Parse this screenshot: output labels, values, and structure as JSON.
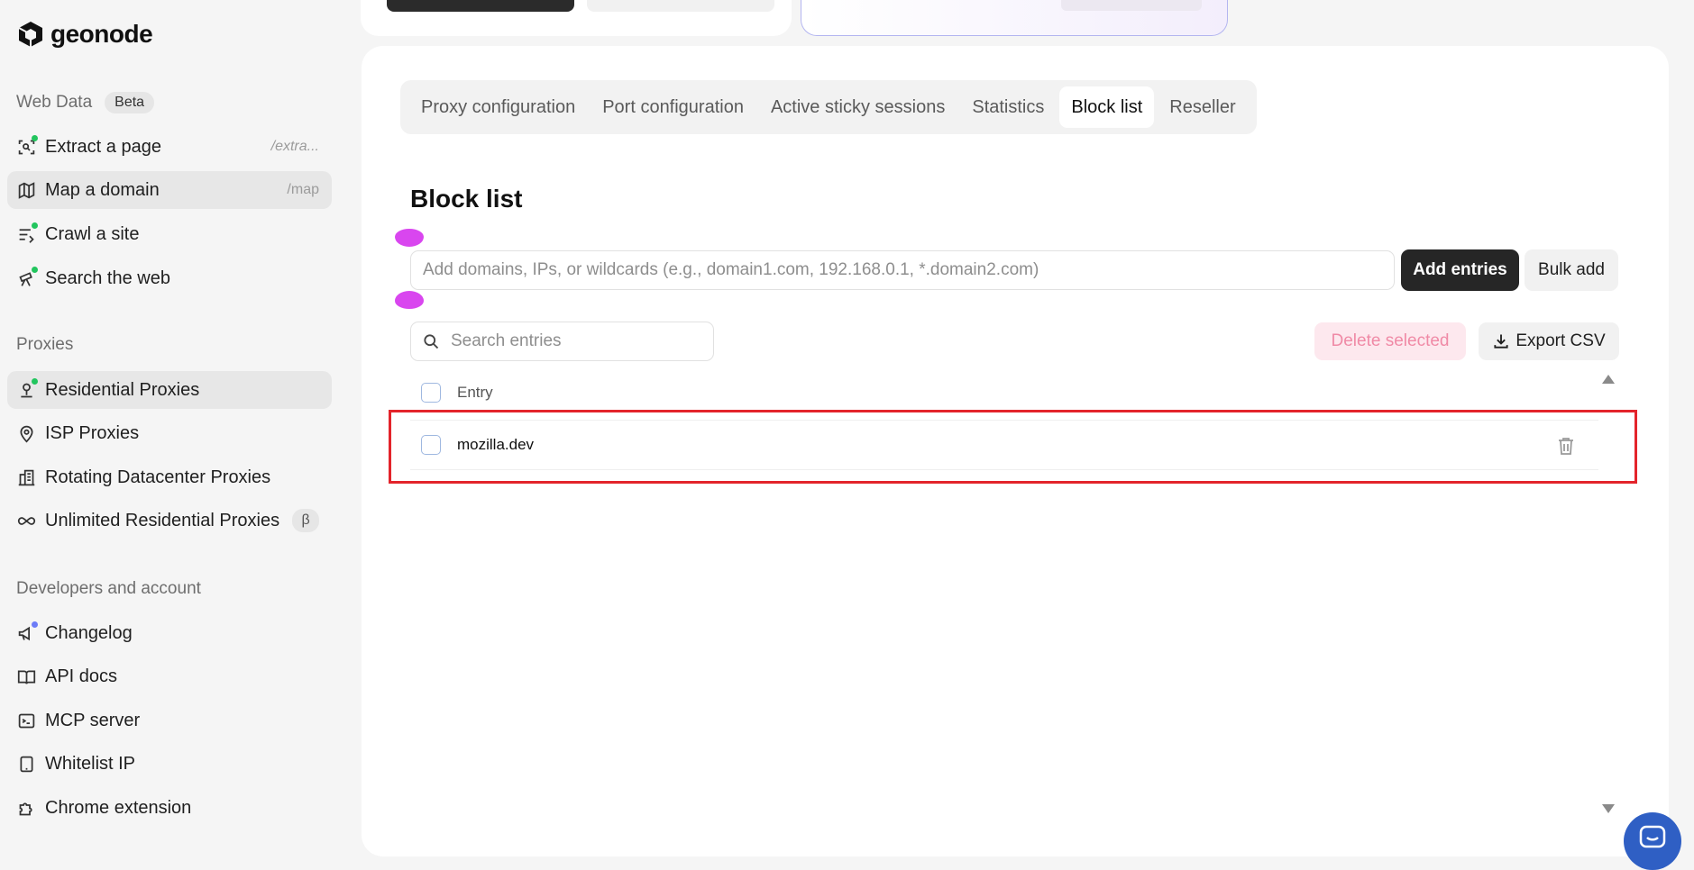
{
  "brand": {
    "name": "geonode"
  },
  "sidebar": {
    "web_data": {
      "title": "Web Data",
      "badge": "Beta",
      "items": [
        {
          "label": "Extract a page",
          "shortcut": "/extra..."
        },
        {
          "label": "Map a domain",
          "shortcut": "/map"
        },
        {
          "label": "Crawl a site"
        },
        {
          "label": "Search the web"
        }
      ]
    },
    "proxies": {
      "title": "Proxies",
      "items": [
        {
          "label": "Residential Proxies"
        },
        {
          "label": "ISP Proxies"
        },
        {
          "label": "Rotating Datacenter Proxies"
        },
        {
          "label": "Unlimited Residential Proxies",
          "badge": "β"
        }
      ]
    },
    "developers": {
      "title": "Developers and account",
      "items": [
        {
          "label": "Changelog"
        },
        {
          "label": "API docs"
        },
        {
          "label": "MCP server"
        },
        {
          "label": "Whitelist IP"
        },
        {
          "label": "Chrome extension"
        }
      ]
    }
  },
  "tabs": [
    {
      "label": "Proxy configuration",
      "active": false
    },
    {
      "label": "Port configuration",
      "active": false
    },
    {
      "label": "Active sticky sessions",
      "active": false
    },
    {
      "label": "Statistics",
      "active": false
    },
    {
      "label": "Block list",
      "active": true
    },
    {
      "label": "Reseller",
      "active": false
    }
  ],
  "blocklist": {
    "title": "Block list",
    "input_placeholder": "Add domains, IPs, or wildcards (e.g., domain1.com, 192.168.0.1, *.domain2.com)",
    "add_button": "Add entries",
    "bulk_button": "Bulk add",
    "search_placeholder": "Search entries",
    "delete_button": "Delete selected",
    "export_button": "Export CSV",
    "column_header": "Entry",
    "entries": [
      {
        "value": "mozilla.dev",
        "checked": false
      }
    ]
  },
  "colors": {
    "accent_dark": "#262626",
    "active_dot": "#22c55e",
    "highlight": "#e3242b",
    "marker": "#d946ef",
    "delete_disabled": "#f08aa6",
    "chat": "#2f5fc4"
  },
  "icons": {
    "extract": "scan-search-icon",
    "map": "map-icon",
    "crawl": "crawl-icon",
    "search_web": "telescope-icon",
    "residential": "residential-pin-icon",
    "isp": "location-pin-icon",
    "datacenter": "building-icon",
    "unlimited": "infinity-icon",
    "changelog": "megaphone-icon",
    "api": "book-icon",
    "mcp": "terminal-icon",
    "whitelist": "tablet-icon",
    "chrome": "puzzle-icon",
    "search": "search-icon",
    "export": "download-icon",
    "delete_row": "trash-icon",
    "chat": "chat-icon"
  }
}
